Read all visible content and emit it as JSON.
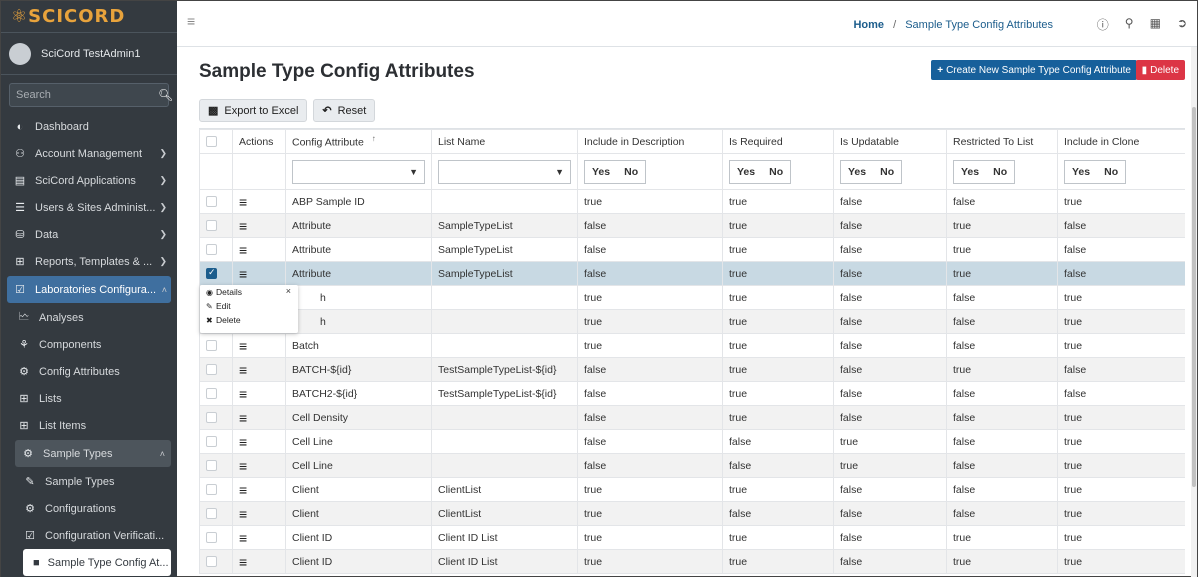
{
  "brand": {
    "logo_icon": "flask-icon",
    "name": "SCICORD"
  },
  "user": {
    "name": "SciCord TestAdmin1"
  },
  "search": {
    "placeholder": "Search"
  },
  "sidebar": {
    "items": [
      {
        "label": "Dashboard",
        "icon": "◐"
      },
      {
        "label": "Account Management",
        "icon": "⚇"
      },
      {
        "label": "SciCord Applications",
        "icon": "▤"
      },
      {
        "label": "Users & Sites Administ...",
        "icon": "☰"
      },
      {
        "label": "Data",
        "icon": "⛁"
      },
      {
        "label": "Reports, Templates & ...",
        "icon": "⊞"
      },
      {
        "label": "Laboratories Configura...",
        "icon": "☑"
      },
      {
        "label": "Analyses",
        "icon": "⮂"
      },
      {
        "label": "Components",
        "icon": "⚘"
      },
      {
        "label": "Config Attributes",
        "icon": "⚙"
      },
      {
        "label": "Lists",
        "icon": "⊞"
      },
      {
        "label": "List Items",
        "icon": "⊞"
      },
      {
        "label": "Sample Types",
        "icon": "⚙"
      },
      {
        "label": "Sample Types",
        "icon": "✎"
      },
      {
        "label": "Configurations",
        "icon": "⚙"
      },
      {
        "label": "Configuration Verificati...",
        "icon": "☑"
      },
      {
        "label": "Sample Type Config At...",
        "icon": "■"
      }
    ]
  },
  "breadcrumb": {
    "home": "Home",
    "separator": "/",
    "current": "Sample Type Config Attributes"
  },
  "page": {
    "title": "Sample Type Config Attributes"
  },
  "actions": {
    "create": "Create New Sample Type Config Attribute",
    "delete": "Delete"
  },
  "toolbar": {
    "export": "Export to Excel",
    "reset": "Reset"
  },
  "table": {
    "headers": [
      "",
      "Actions",
      "Config Attribute",
      "List Name",
      "Include in Description",
      "Is Required",
      "Is Updatable",
      "Restricted To List",
      "Include in Clone"
    ],
    "sort_indicator": "↑",
    "yes": "Yes",
    "no": "No",
    "rows": [
      {
        "attr": "ABP Sample ID",
        "list": "",
        "desc": "true",
        "req": "true",
        "upd": "false",
        "restr": "false",
        "clone": "true"
      },
      {
        "attr": "Attribute",
        "list": "SampleTypeList",
        "desc": "false",
        "req": "true",
        "upd": "false",
        "restr": "true",
        "clone": "false"
      },
      {
        "attr": "Attribute",
        "list": "SampleTypeList",
        "desc": "false",
        "req": "true",
        "upd": "false",
        "restr": "true",
        "clone": "false"
      },
      {
        "attr": "Attribute",
        "list": "SampleTypeList",
        "desc": "false",
        "req": "true",
        "upd": "false",
        "restr": "true",
        "clone": "false"
      },
      {
        "attr": "h",
        "list": "",
        "desc": "true",
        "req": "true",
        "upd": "false",
        "restr": "false",
        "clone": "true"
      },
      {
        "attr": "h",
        "list": "",
        "desc": "true",
        "req": "true",
        "upd": "false",
        "restr": "false",
        "clone": "true"
      },
      {
        "attr": "Batch",
        "list": "",
        "desc": "true",
        "req": "true",
        "upd": "false",
        "restr": "false",
        "clone": "true"
      },
      {
        "attr": "BATCH-${id}",
        "list": "TestSampleTypeList-${id}",
        "desc": "false",
        "req": "true",
        "upd": "false",
        "restr": "true",
        "clone": "false"
      },
      {
        "attr": "BATCH2-${id}",
        "list": "TestSampleTypeList-${id}",
        "desc": "false",
        "req": "true",
        "upd": "false",
        "restr": "false",
        "clone": "false"
      },
      {
        "attr": "Cell Density",
        "list": "",
        "desc": "false",
        "req": "true",
        "upd": "false",
        "restr": "false",
        "clone": "true"
      },
      {
        "attr": "Cell Line",
        "list": "",
        "desc": "false",
        "req": "false",
        "upd": "true",
        "restr": "false",
        "clone": "true"
      },
      {
        "attr": "Cell Line",
        "list": "",
        "desc": "false",
        "req": "false",
        "upd": "true",
        "restr": "false",
        "clone": "true"
      },
      {
        "attr": "Client",
        "list": "ClientList",
        "desc": "true",
        "req": "true",
        "upd": "false",
        "restr": "false",
        "clone": "true"
      },
      {
        "attr": "Client",
        "list": "ClientList",
        "desc": "true",
        "req": "false",
        "upd": "false",
        "restr": "false",
        "clone": "true"
      },
      {
        "attr": "Client ID",
        "list": "Client ID List",
        "desc": "true",
        "req": "true",
        "upd": "false",
        "restr": "true",
        "clone": "true"
      },
      {
        "attr": "Client ID",
        "list": "Client ID List",
        "desc": "true",
        "req": "true",
        "upd": "false",
        "restr": "true",
        "clone": "true"
      }
    ]
  },
  "context_menu": {
    "details": "Details",
    "edit": "Edit",
    "delete": "Delete"
  }
}
